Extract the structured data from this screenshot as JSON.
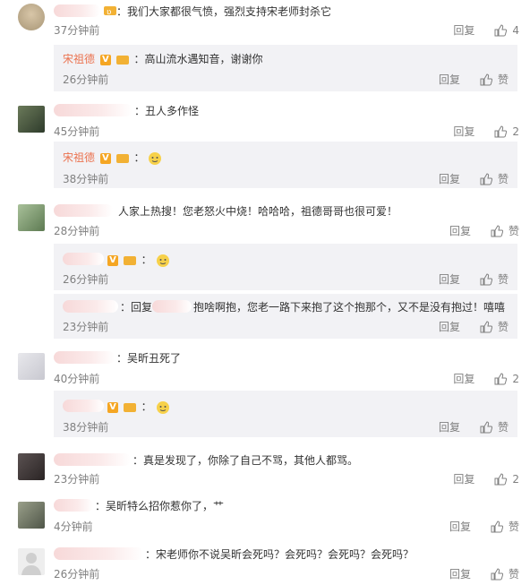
{
  "labels": {
    "reply": "回复",
    "like": "赞"
  },
  "comments": [
    {
      "text": "：我们大家都很气愤，强烈支持宋老师封杀它",
      "time": "37分钟前",
      "likes": "4"
    },
    {
      "author": "宋祖德",
      "text": "：高山流水遇知音，谢谢你",
      "time": "26分钟前"
    },
    {
      "text": "：丑人多作怪",
      "time": "45分钟前",
      "likes": "2"
    },
    {
      "author": "宋祖德",
      "text": "：",
      "time": "38分钟前"
    },
    {
      "text": "人家上热搜！您老怒火中烧！哈哈哈，祖德哥哥也很可爱！",
      "time": "28分钟前"
    },
    {
      "text": "：",
      "time": "26分钟前"
    },
    {
      "text_a": "：回复",
      "text_b": "抱啥啊抱，您老一路下来抱了这个抱那个，又不是没有抱过！嘻嘻",
      "time": "23分钟前"
    },
    {
      "text": "：吴昕丑死了",
      "time": "40分钟前",
      "likes": "2"
    },
    {
      "text": "：",
      "time": "38分钟前"
    },
    {
      "text": "：真是发现了，你除了自己不骂，其他人都骂。",
      "time": "23分钟前",
      "likes": "2"
    },
    {
      "text": "：吴昕特么招你惹你了，艹",
      "time": "4分钟前"
    },
    {
      "text": "：宋老师你不说吴昕会死吗？会死吗？会死吗？会死吗？",
      "time": "26分钟前"
    }
  ]
}
